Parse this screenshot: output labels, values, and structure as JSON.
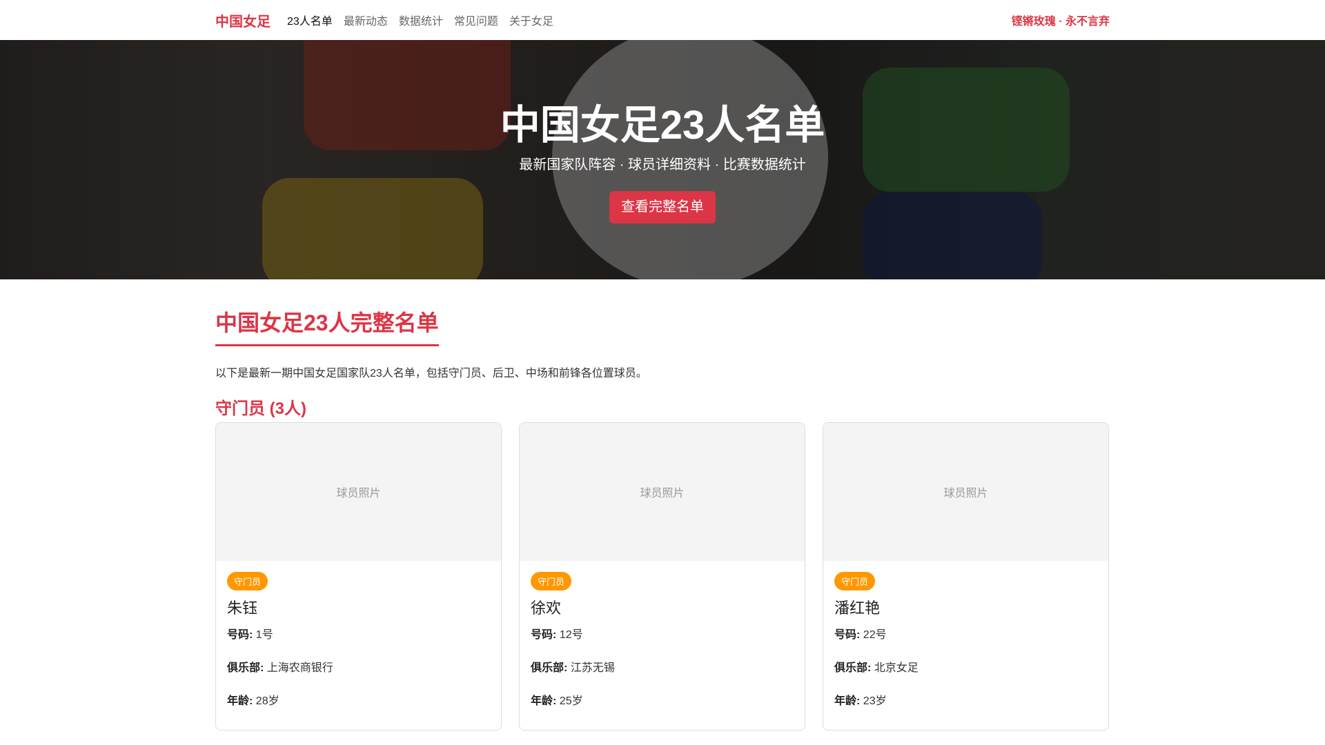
{
  "nav": {
    "brand": "中国女足",
    "items": [
      "23人名单",
      "最新动态",
      "数据统计",
      "常见问题",
      "关于女足"
    ],
    "slogan": "铿锵玫瑰 · 永不言弃"
  },
  "hero": {
    "title": "中国女足23人名单",
    "subtitle": "最新国家队阵容 · 球员详细资料 · 比赛数据统计",
    "button": "查看完整名单"
  },
  "section": {
    "title": "中国女足23人完整名单",
    "description": "以下是最新一期中国女足国家队23人名单，包括守门员、后卫、中场和前锋各位置球员。",
    "goalkeepers_heading": "守门员 (3人)"
  },
  "labels": {
    "photo": "球员照片",
    "number": "号码:",
    "club": "俱乐部:",
    "age": "年龄:"
  },
  "players": [
    {
      "position": "守门员",
      "name": "朱钰",
      "number": "1号",
      "club": "上海农商银行",
      "age": "28岁"
    },
    {
      "position": "守门员",
      "name": "徐欢",
      "number": "12号",
      "club": "江苏无锡",
      "age": "25岁"
    },
    {
      "position": "守门员",
      "name": "潘红艳",
      "number": "22号",
      "club": "北京女足",
      "age": "23岁"
    }
  ]
}
